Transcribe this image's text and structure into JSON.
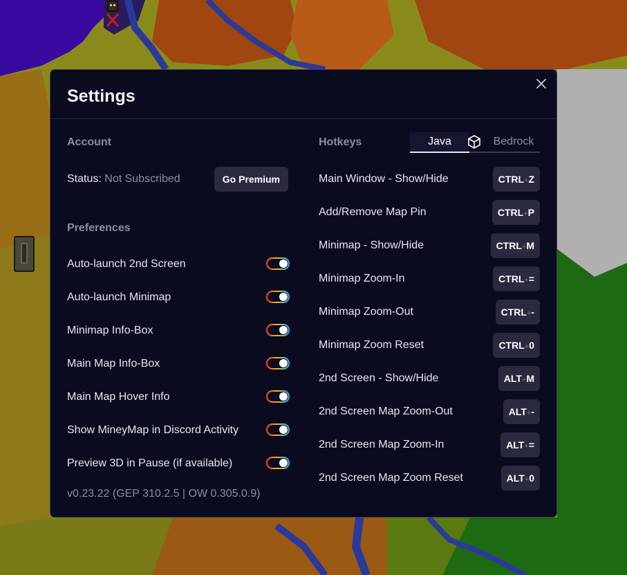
{
  "modal": {
    "title": "Settings"
  },
  "account": {
    "section_label": "Account",
    "status_label": "Status:",
    "status_value": "Not Subscribed",
    "premium_button": "Go Premium"
  },
  "preferences": {
    "section_label": "Preferences",
    "items": [
      {
        "label": "Auto-launch 2nd Screen",
        "enabled": true
      },
      {
        "label": "Auto-launch Minimap",
        "enabled": true
      },
      {
        "label": "Minimap Info-Box",
        "enabled": true
      },
      {
        "label": "Main Map Info-Box",
        "enabled": true
      },
      {
        "label": "Main Map Hover Info",
        "enabled": true
      },
      {
        "label": "Show MineyMap in Discord Activity",
        "enabled": true
      },
      {
        "label": "Preview 3D in Pause (if available)",
        "enabled": true
      }
    ]
  },
  "version": "v0.23.22 (GEP 310.2.5 | OW 0.305.0.9)",
  "hotkeys": {
    "section_label": "Hotkeys",
    "tabs": {
      "java": "Java",
      "bedrock": "Bedrock",
      "active": "java"
    },
    "items": [
      {
        "label": "Main Window - Show/Hide",
        "mod": "CTRL",
        "key": "Z"
      },
      {
        "label": "Add/Remove Map Pin",
        "mod": "CTRL",
        "key": "P"
      },
      {
        "label": "Minimap - Show/Hide",
        "mod": "CTRL",
        "key": "M"
      },
      {
        "label": "Minimap Zoom-In",
        "mod": "CTRL",
        "key": "="
      },
      {
        "label": "Minimap Zoom-Out",
        "mod": "CTRL",
        "key": "-"
      },
      {
        "label": "Minimap Zoom Reset",
        "mod": "CTRL",
        "key": "0"
      },
      {
        "label": "2nd Screen - Show/Hide",
        "mod": "ALT",
        "key": "M"
      },
      {
        "label": "2nd Screen Map Zoom-Out",
        "mod": "ALT",
        "key": "-"
      },
      {
        "label": "2nd Screen Map Zoom-In",
        "mod": "ALT",
        "key": "="
      },
      {
        "label": "2nd Screen Map Zoom Reset",
        "mod": "ALT",
        "key": "0"
      }
    ],
    "plus_symbol": "+"
  },
  "colors": {
    "modal_bg": "#0b0b1f",
    "toggle_gradient_start": "#ff3a2f",
    "toggle_gradient_mid": "#ffb11a",
    "toggle_gradient_end": "#18b8ff",
    "muted_text": "#8c8ca3",
    "key_bg": "#2a2a3e"
  },
  "icons": {
    "close": "close-icon",
    "bedrock_tab": "cube-icon",
    "map_pin": "player-pin-icon"
  }
}
